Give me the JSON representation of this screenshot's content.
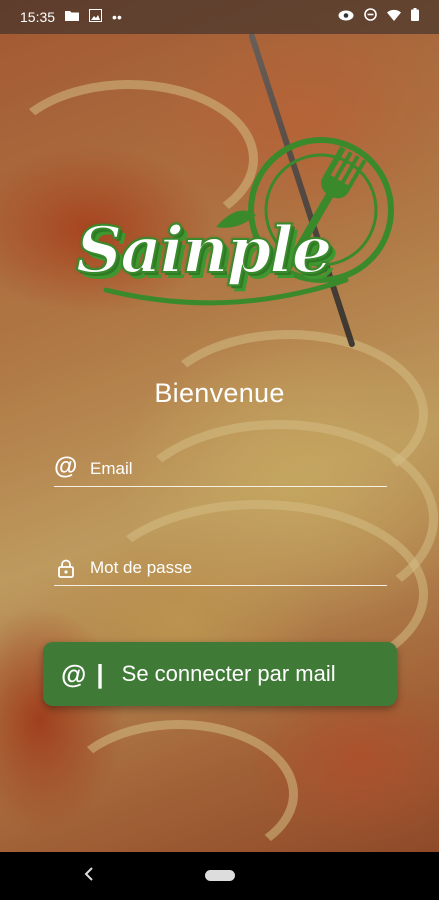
{
  "status_bar": {
    "time": "15:35",
    "left_icons": [
      "folder-icon",
      "image-icon",
      "more-dots-icon"
    ],
    "right_icons": [
      "eye-icon",
      "do-not-disturb-icon",
      "wifi-icon",
      "battery-icon"
    ]
  },
  "logo": {
    "text": "Sainple",
    "icon": "fork-plate-icon",
    "colors": [
      "#3a8a2c",
      "#ffffff"
    ]
  },
  "welcome_title": "Bienvenue",
  "email_field": {
    "icon": "at-icon",
    "placeholder": "Email",
    "value": ""
  },
  "password_field": {
    "icon": "lock-icon",
    "placeholder": "Mot de passe",
    "value": ""
  },
  "login_button": {
    "icon": "at-icon",
    "separator": "|",
    "label": "Se connecter par mail",
    "color": "#3f7a37"
  },
  "nav_bar": {
    "back_icon": "back-chevron-icon",
    "home_icon": "home-pill-icon"
  }
}
